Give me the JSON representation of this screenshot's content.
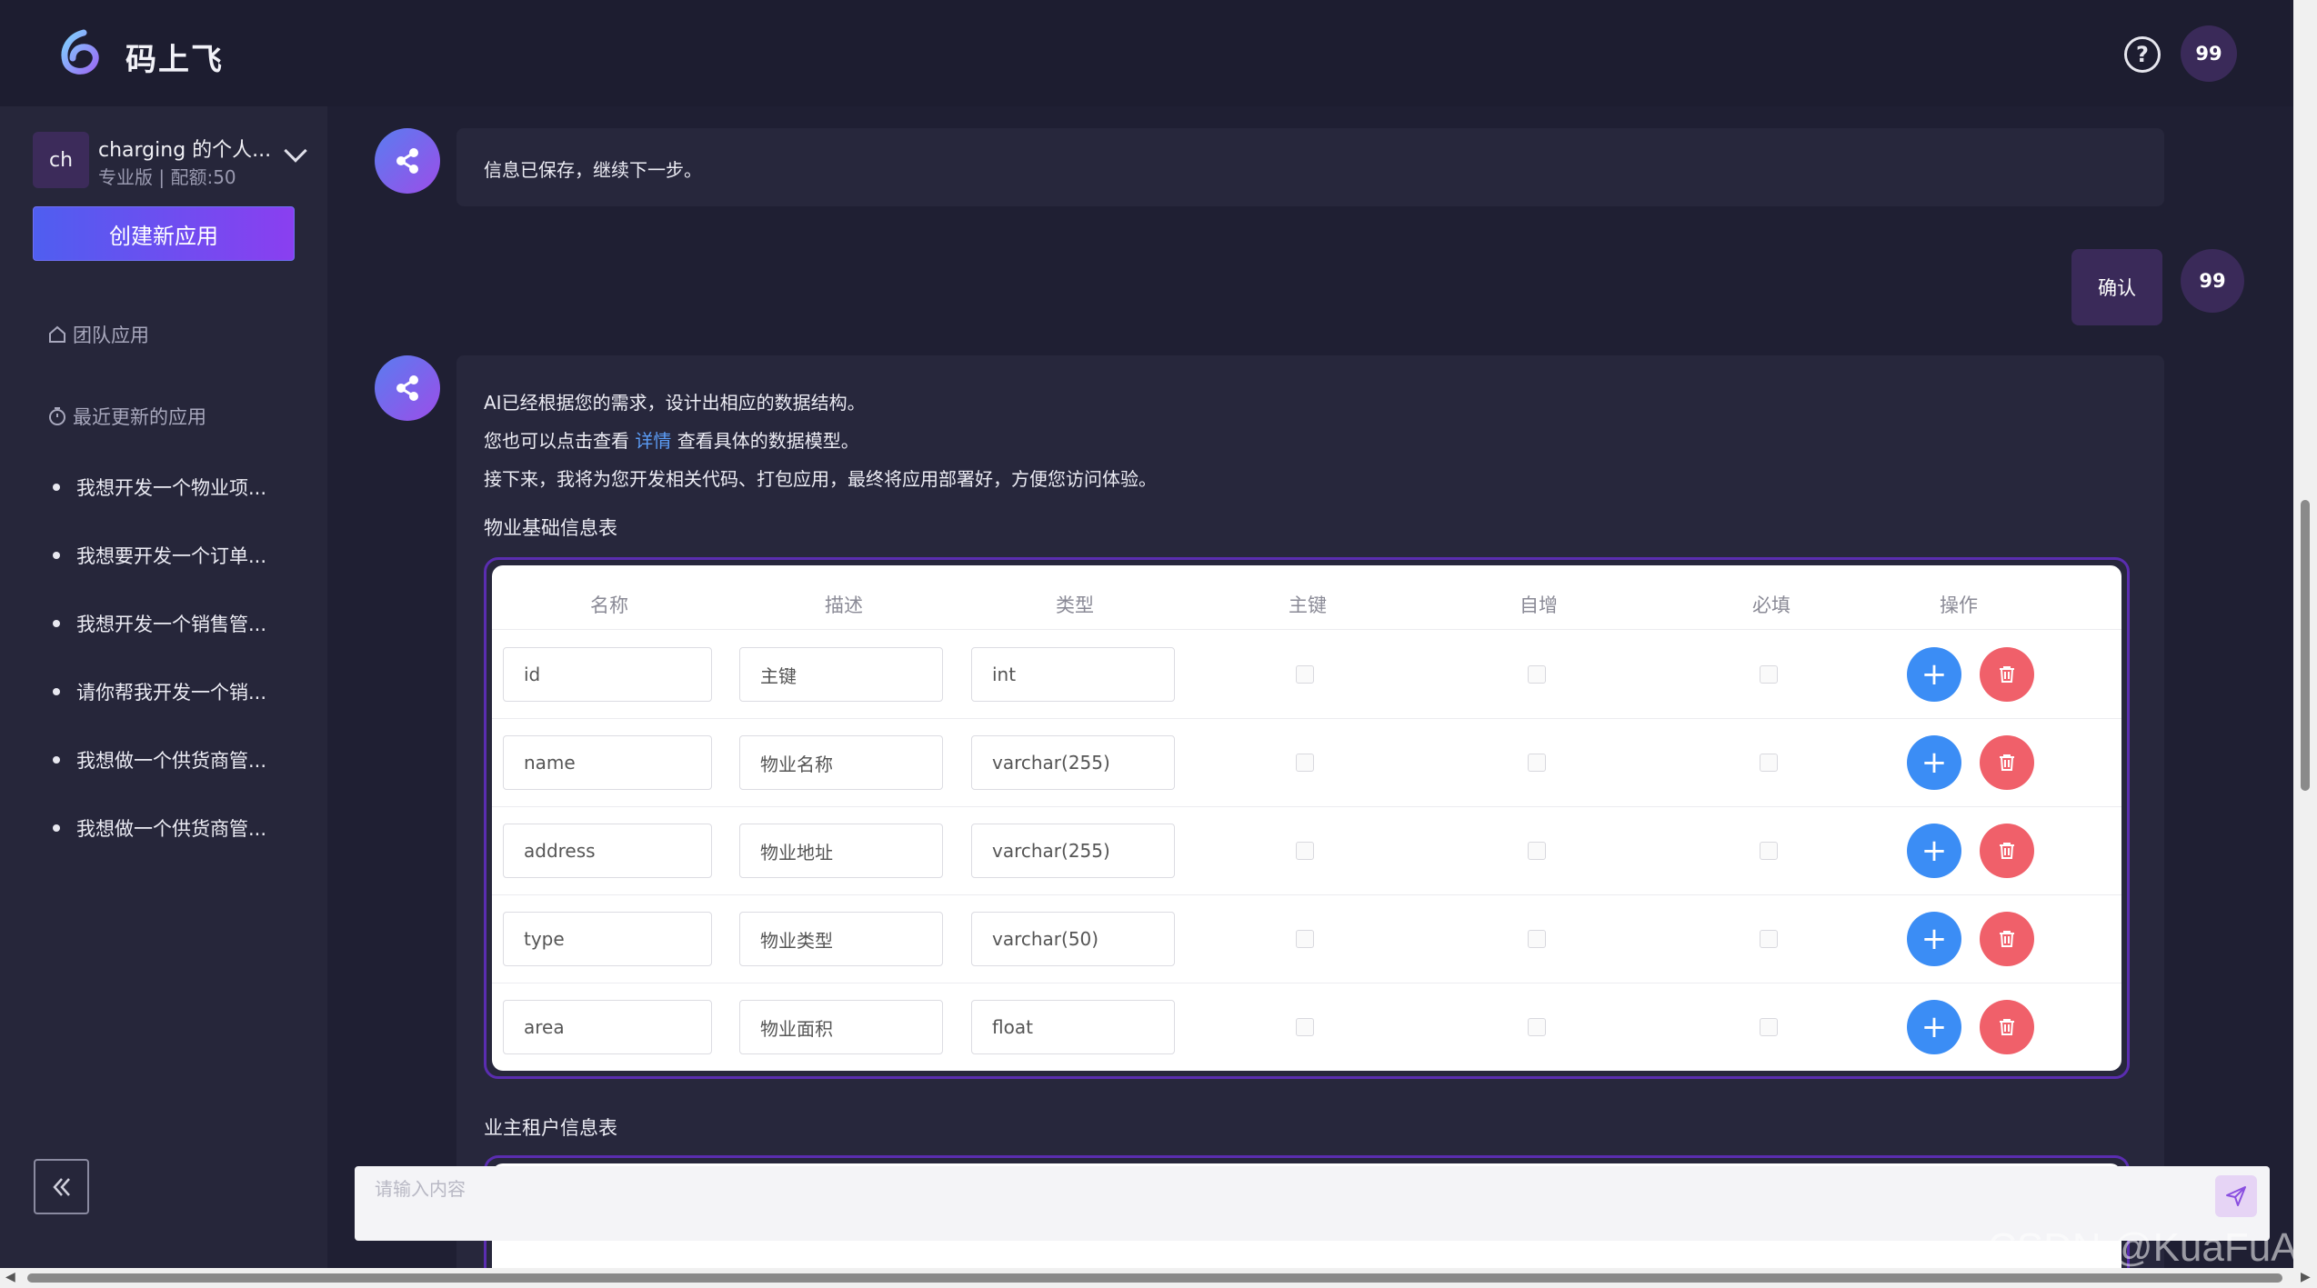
{
  "header": {
    "brand": "码上飞",
    "user_avatar": "99"
  },
  "sidebar": {
    "team_avatar": "ch",
    "team_name": "charging 的个人...",
    "team_sub": "专业版 | 配额:50",
    "create_label": "创建新应用",
    "team_apps_label": "团队应用",
    "recent_label": "最近更新的应用",
    "recent": [
      "我想开发一个物业项...",
      "我想要开发一个订单...",
      "我想开发一个销售管...",
      "请你帮我开发一个销...",
      "我想做一个供货商管...",
      "我想做一个供货商管..."
    ]
  },
  "chat": {
    "msg1": "信息已保存，继续下一步。",
    "user_msg": "确认",
    "user_avatar": "99",
    "ai_line1": "AI已经根据您的需求，设计出相应的数据结构。",
    "ai_line2_pre": "您也可以点击查看",
    "ai_line2_link": "详情",
    "ai_line2_post": "查看具体的数据模型。",
    "ai_line3": "接下来，我将为您开发相关代码、打包应用，最终将应用部署好，方便您访问体验。",
    "table1_title": "物业基础信息表",
    "table2_title": "业主租户信息表"
  },
  "table": {
    "headers": {
      "name": "名称",
      "desc": "描述",
      "type": "类型",
      "pk": "主键",
      "auto": "自增",
      "required": "必填",
      "ops": "操作"
    },
    "rows": [
      {
        "name": "id",
        "desc": "主键",
        "type": "int"
      },
      {
        "name": "name",
        "desc": "物业名称",
        "type": "varchar(255)"
      },
      {
        "name": "address",
        "desc": "物业地址",
        "type": "varchar(255)"
      },
      {
        "name": "type",
        "desc": "物业类型",
        "type": "varchar(50)"
      },
      {
        "name": "area",
        "desc": "物业面积",
        "type": "float"
      }
    ]
  },
  "composer": {
    "placeholder": "请输入内容"
  },
  "watermark": "CSDN @KuaFuAI",
  "colors": {
    "accent": "#3b8df5",
    "danger": "#f0606a",
    "brand_purple": "#5a2db0"
  }
}
